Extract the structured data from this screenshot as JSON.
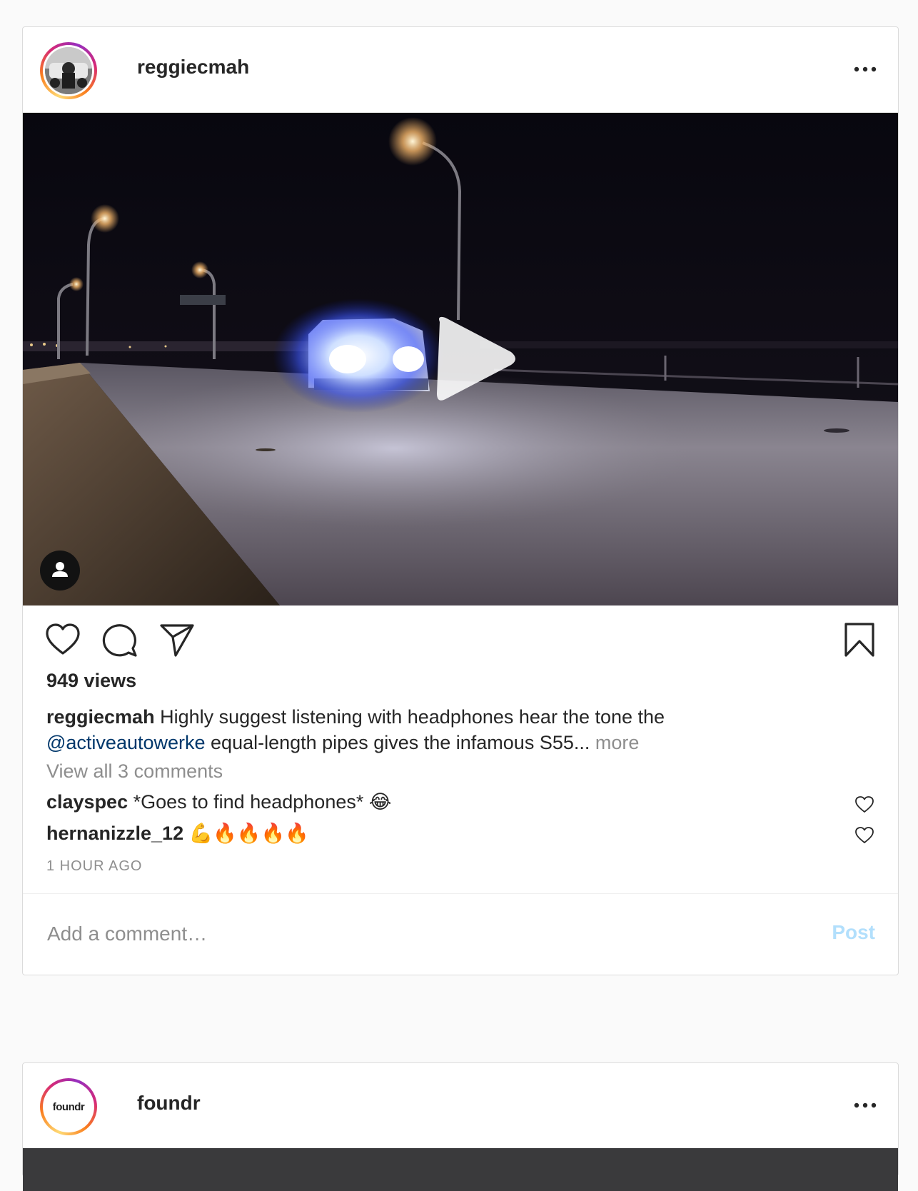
{
  "colors": {
    "background": "#fafafa",
    "card": "#ffffff",
    "border": "#dbdbdb",
    "text": "#262626",
    "muted": "#8e8e8e",
    "mention": "#00376b",
    "post_button_disabled": "#b2dffc"
  },
  "posts": [
    {
      "username": "reggiecmah",
      "avatar_icon": "profile-photo",
      "more_icon": "ellipsis-icon",
      "media": {
        "type": "video",
        "play_icon": "play-icon",
        "tag_icon": "user-tag-icon"
      },
      "actions": {
        "like_icon": "heart-outline-icon",
        "comment_icon": "speech-bubble-icon",
        "share_icon": "paper-plane-icon",
        "save_icon": "bookmark-icon"
      },
      "views": "949 views",
      "caption": {
        "username": "reggiecmah",
        "text_before": "Highly suggest listening with headphones hear the tone the",
        "mention": "@activeautowerke",
        "text_after": "equal-length pipes gives the infamous S55...",
        "more": "more"
      },
      "view_all_comments": "View all 3 comments",
      "comments": [
        {
          "username": "clayspec",
          "text": "*Goes to find headphones* 😂"
        },
        {
          "username": "hernanizzle_12",
          "text": "💪🔥🔥🔥🔥"
        }
      ],
      "timestamp": "1 HOUR AGO",
      "comment_placeholder": "Add a comment…",
      "post_button": "Post"
    },
    {
      "username": "foundr",
      "avatar_logo_text": "foundr",
      "more_icon": "ellipsis-icon"
    }
  ]
}
